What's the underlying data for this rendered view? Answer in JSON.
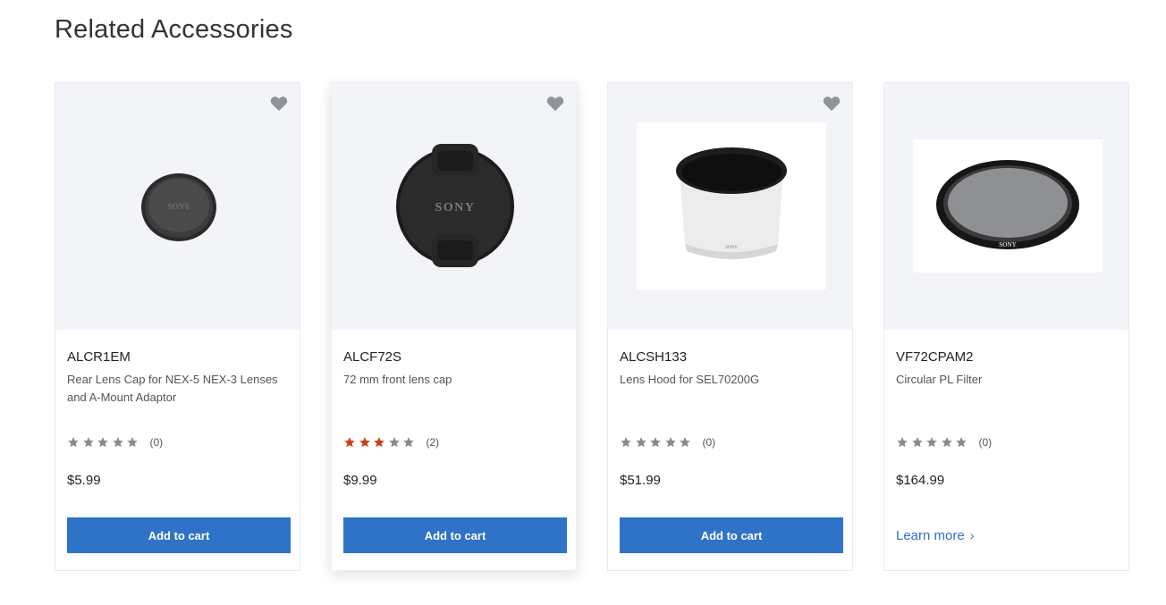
{
  "section": {
    "title": "Related Accessories"
  },
  "products": [
    {
      "sku": "ALCR1EM",
      "description": "Rear Lens Cap for NEX-5 NEX-3 Lenses and A-Mount Adaptor",
      "rating": 0,
      "review_count": "(0)",
      "price": "$5.99",
      "action_label": "Add to cart",
      "brand_mark": "SONY"
    },
    {
      "sku": "ALCF72S",
      "description": "72 mm front lens cap",
      "rating": 3,
      "review_count": "(2)",
      "price": "$9.99",
      "action_label": "Add to cart",
      "brand_mark": "SONY"
    },
    {
      "sku": "ALCSH133",
      "description": "Lens Hood for SEL70200G",
      "rating": 0,
      "review_count": "(0)",
      "price": "$51.99",
      "action_label": "Add to cart",
      "brand_mark": "SONY"
    },
    {
      "sku": "VF72CPAM2",
      "description": "Circular PL Filter",
      "rating": 0,
      "review_count": "(0)",
      "price": "$164.99",
      "action_label": "Learn more",
      "brand_mark": "SONY"
    }
  ],
  "icons": {
    "favorite": "heart-icon",
    "star": "star-icon",
    "chevron": "chevron-right-icon"
  },
  "colors": {
    "button": "#2f73c8",
    "link": "#2f6ec8",
    "star_filled": "#c8411b",
    "star_empty": "#8a8a8a",
    "heart": "#8f949b"
  }
}
